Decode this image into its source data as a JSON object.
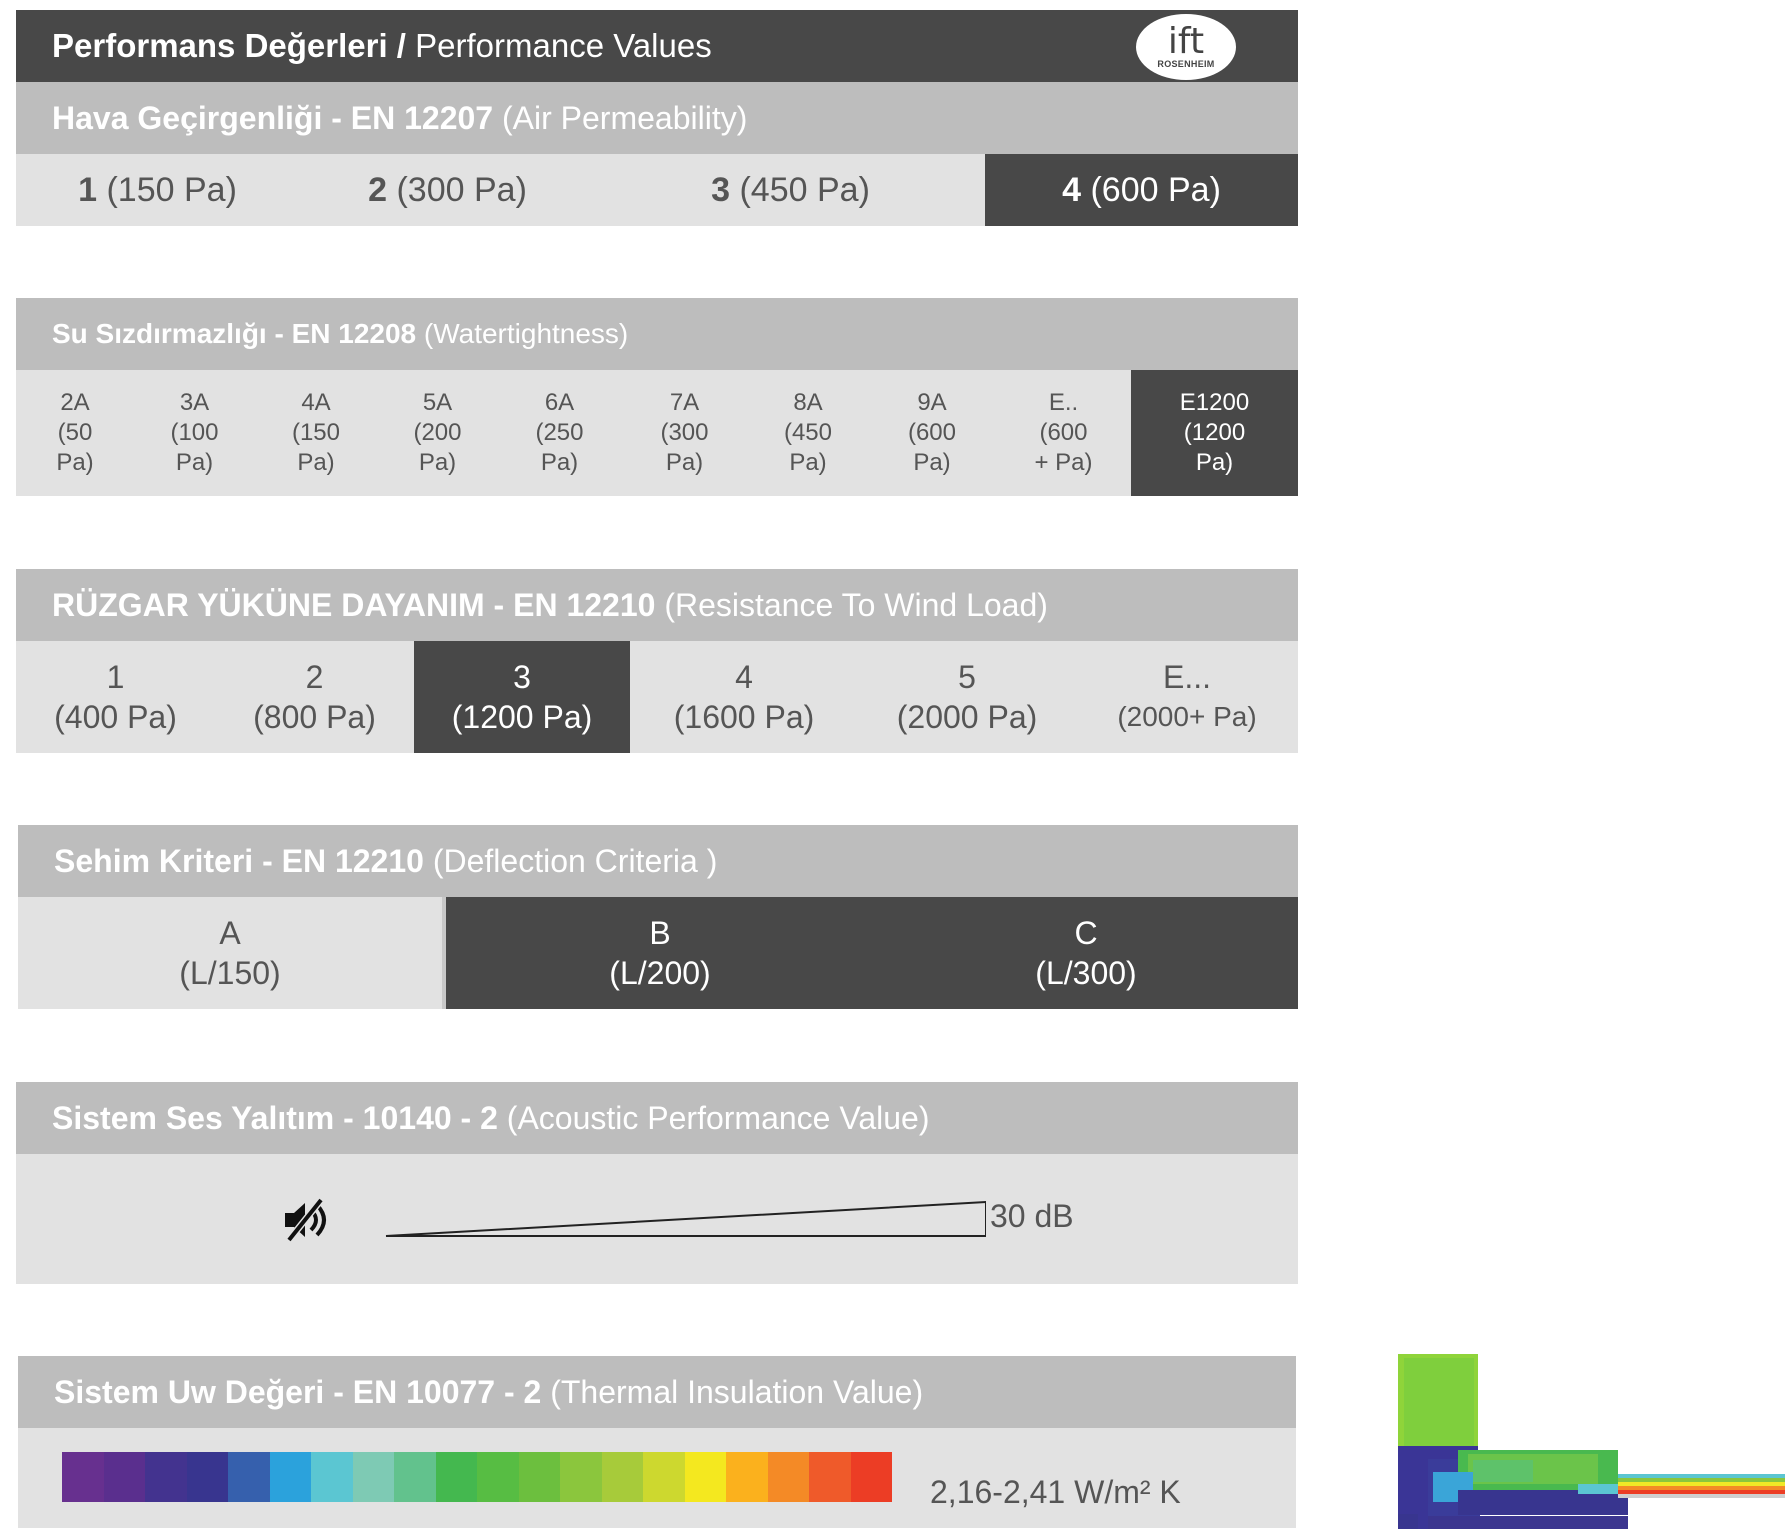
{
  "header": {
    "title_bold": "Performans Değerleri /",
    "title_light": "Performance Values"
  },
  "logo": {
    "line1": "ift",
    "line2": "ROSENHEIM"
  },
  "air": {
    "title_bold": "Hava Geçirgenliği - EN 12207",
    "title_light": "(Air Permeability)",
    "classes": [
      {
        "num": "1",
        "pa": "(150 Pa)",
        "active": false
      },
      {
        "num": "2",
        "pa": "(300 Pa)",
        "active": false
      },
      {
        "num": "3",
        "pa": "(450 Pa)",
        "active": false
      },
      {
        "num": "4",
        "pa": "(600 Pa)",
        "active": true
      }
    ]
  },
  "water": {
    "title_bold": "Su Sızdırmazlığı - EN 12208",
    "title_light": "(Watertightness)",
    "classes": [
      {
        "l1": "2A",
        "l2": "(50",
        "l3": "Pa)",
        "active": false
      },
      {
        "l1": "3A",
        "l2": "(100",
        "l3": "Pa)",
        "active": false
      },
      {
        "l1": "4A",
        "l2": "(150",
        "l3": "Pa)",
        "active": false
      },
      {
        "l1": "5A",
        "l2": "(200",
        "l3": "Pa)",
        "active": false
      },
      {
        "l1": "6A",
        "l2": "(250",
        "l3": "Pa)",
        "active": false
      },
      {
        "l1": "7A",
        "l2": "(300",
        "l3": "Pa)",
        "active": false
      },
      {
        "l1": "8A",
        "l2": "(450",
        "l3": "Pa)",
        "active": false
      },
      {
        "l1": "9A",
        "l2": "(600",
        "l3": "Pa)",
        "active": false
      },
      {
        "l1": "E..",
        "l2": "(600",
        "l3": "+ Pa)",
        "active": false
      },
      {
        "l1": "E1200",
        "l2": "(1200",
        "l3": "Pa)",
        "active": true
      }
    ]
  },
  "wind": {
    "title_bold": "RÜZGAR YÜKÜNE DAYANIM - EN 12210",
    "title_light": "(Resistance To Wind Load)",
    "classes": [
      {
        "l1": "1",
        "l2": "(400 Pa)",
        "active": false
      },
      {
        "l1": "2",
        "l2": "(800 Pa)",
        "active": false
      },
      {
        "l1": "3",
        "l2": "(1200 Pa)",
        "active": true
      },
      {
        "l1": "4",
        "l2": "(1600 Pa)",
        "active": false
      },
      {
        "l1": "5",
        "l2": "(2000 Pa)",
        "active": false
      },
      {
        "l1": "E...",
        "l2": "(2000+ Pa)",
        "active": false
      }
    ]
  },
  "deflection": {
    "title_bold": "Sehim Kriteri - EN 12210",
    "title_light": "(Deflection Criteria )",
    "classes": [
      {
        "l1": "A",
        "l2": "(L/150)",
        "active": false
      },
      {
        "l1": "B",
        "l2": "(L/200)",
        "active": true
      },
      {
        "l1": "C",
        "l2": "(L/300)",
        "active": true
      }
    ]
  },
  "acoustic": {
    "title_bold": "Sistem Ses Yalıtım - 10140 - 2",
    "title_light": "(Acoustic Performance Value)",
    "icon": "mute-icon",
    "value": "30 dB"
  },
  "thermal": {
    "title_bold": "Sistem Uw Değeri - EN 10077 - 2",
    "title_light": "(Thermal Insulation Value)",
    "value": "2,16-2,41 W/m² K",
    "scale_colors": [
      "#67308f",
      "#5a2f8e",
      "#43338f",
      "#38358f",
      "#3660ad",
      "#2ba2dc",
      "#5bc6d2",
      "#7ecab4",
      "#62c28d",
      "#44b84f",
      "#57bd43",
      "#6cbf3e",
      "#8bc63d",
      "#a7cb3a",
      "#cdd82f",
      "#f4e81f",
      "#fbb11d",
      "#f48a26",
      "#ef5a2a",
      "#ec3d25"
    ]
  }
}
